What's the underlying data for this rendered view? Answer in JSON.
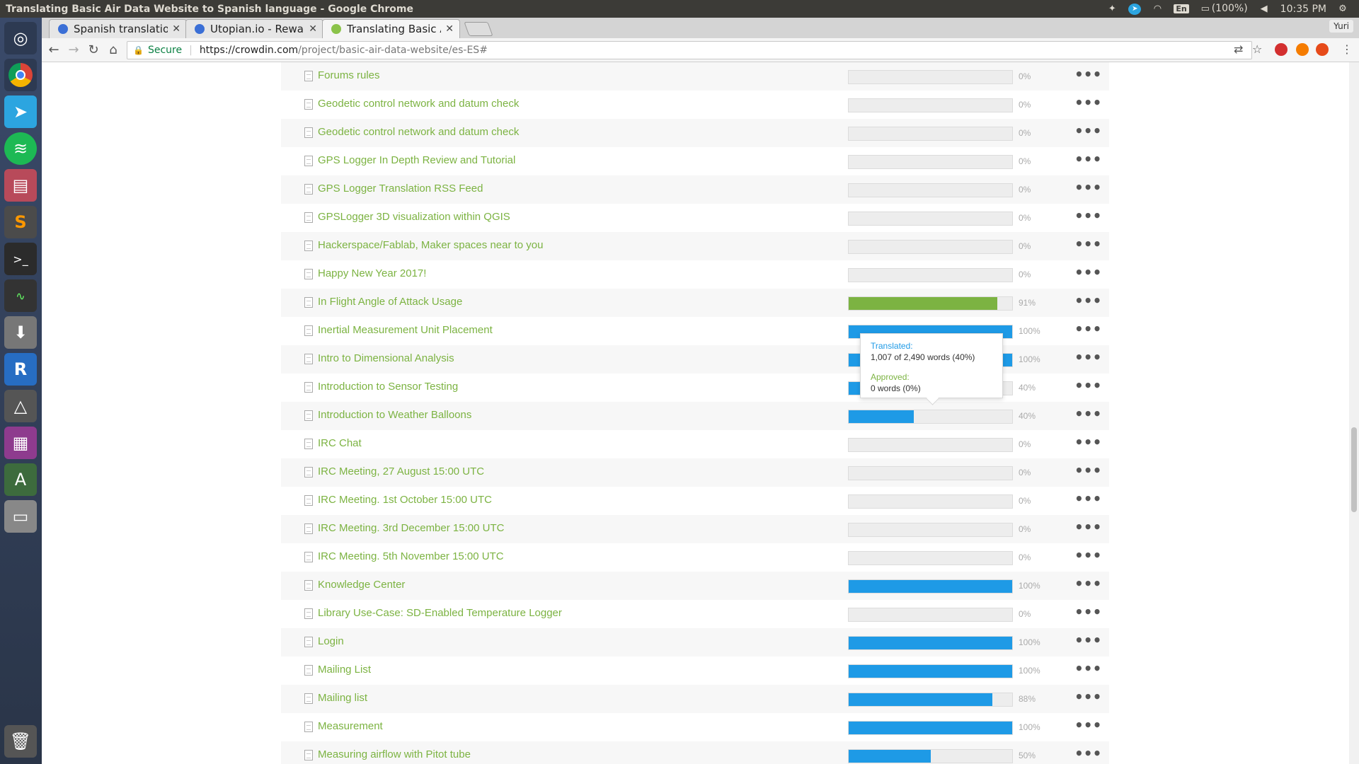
{
  "window": {
    "title": "Translating Basic Air Data Website to Spanish language - Google Chrome",
    "tray": {
      "language": "En",
      "battery": "(100%)",
      "clock": "10:35 PM"
    }
  },
  "tabs": [
    {
      "label": "Spanish translation",
      "active": false
    },
    {
      "label": "Utopian.io - Reward",
      "active": false
    },
    {
      "label": "Translating Basic Ai",
      "active": true
    }
  ],
  "user_badge": "Yuri",
  "omnibox": {
    "secure_label": "Secure",
    "url_host": "https://crowdin.com",
    "url_path": "/project/basic-air-data-website/es-ES#"
  },
  "colors": {
    "link_green": "#7cb342",
    "translated_blue": "#1e9ae6",
    "approved_green": "#7cb342",
    "bar_bg": "#ededed"
  },
  "files": [
    {
      "name": "Forums rules",
      "percent": 0,
      "percent_label": "0%",
      "state": "none"
    },
    {
      "name": "Geodetic control network and datum check",
      "percent": 0,
      "percent_label": "0%",
      "state": "none"
    },
    {
      "name": "Geodetic control network and datum check",
      "percent": 0,
      "percent_label": "0%",
      "state": "none"
    },
    {
      "name": "GPS Logger In Depth Review and Tutorial",
      "percent": 0,
      "percent_label": "0%",
      "state": "none"
    },
    {
      "name": "GPS Logger Translation RSS Feed",
      "percent": 0,
      "percent_label": "0%",
      "state": "none"
    },
    {
      "name": "GPSLogger 3D visualization within QGIS",
      "percent": 0,
      "percent_label": "0%",
      "state": "none"
    },
    {
      "name": "Hackerspace/Fablab, Maker spaces near to you",
      "percent": 0,
      "percent_label": "0%",
      "state": "none"
    },
    {
      "name": "Happy New Year 2017!",
      "percent": 0,
      "percent_label": "0%",
      "state": "none"
    },
    {
      "name": "In Flight Angle of Attack Usage",
      "percent": 91,
      "percent_label": "91%",
      "state": "approved"
    },
    {
      "name": "Inertial Measurement Unit Placement",
      "percent": 100,
      "percent_label": "100%",
      "state": "translated"
    },
    {
      "name": "Intro to Dimensional Analysis",
      "percent": 100,
      "percent_label": "100%",
      "state": "translated"
    },
    {
      "name": "Introduction to Sensor Testing",
      "percent": 40,
      "percent_label": "40%",
      "state": "translated"
    },
    {
      "name": "Introduction to Weather Balloons",
      "percent": 40,
      "percent_label": "40%",
      "state": "translated"
    },
    {
      "name": "IRC Chat",
      "percent": 0,
      "percent_label": "0%",
      "state": "none"
    },
    {
      "name": "IRC Meeting, 27 August 15:00 UTC",
      "percent": 0,
      "percent_label": "0%",
      "state": "none"
    },
    {
      "name": "IRC Meeting. 1st October 15:00 UTC",
      "percent": 0,
      "percent_label": "0%",
      "state": "none"
    },
    {
      "name": "IRC Meeting. 3rd December 15:00 UTC",
      "percent": 0,
      "percent_label": "0%",
      "state": "none"
    },
    {
      "name": "IRC Meeting. 5th November 15:00 UTC",
      "percent": 0,
      "percent_label": "0%",
      "state": "none"
    },
    {
      "name": "Knowledge Center",
      "percent": 100,
      "percent_label": "100%",
      "state": "translated"
    },
    {
      "name": "Library Use-Case: SD-Enabled Temperature Logger",
      "percent": 0,
      "percent_label": "0%",
      "state": "none"
    },
    {
      "name": "Login",
      "percent": 100,
      "percent_label": "100%",
      "state": "translated"
    },
    {
      "name": "Mailing List",
      "percent": 100,
      "percent_label": "100%",
      "state": "translated"
    },
    {
      "name": "Mailing list",
      "percent": 88,
      "percent_label": "88%",
      "state": "translated"
    },
    {
      "name": "Measurement",
      "percent": 100,
      "percent_label": "100%",
      "state": "translated"
    },
    {
      "name": "Measuring airflow with Pitot tube",
      "percent": 50,
      "percent_label": "50%",
      "state": "translated"
    }
  ],
  "tooltip": {
    "translated_label": "Translated:",
    "translated_value": "1,007 of 2,490 words (40%)",
    "approved_label": "Approved:",
    "approved_value": "0 words (0%)"
  },
  "more_label": "•••"
}
